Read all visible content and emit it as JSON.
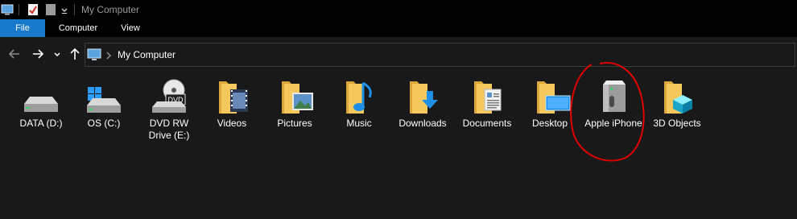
{
  "window": {
    "title": "My Computer"
  },
  "ribbon": {
    "tabs": [
      {
        "label": "File"
      },
      {
        "label": "Computer"
      },
      {
        "label": "View"
      }
    ]
  },
  "address": {
    "path": "My Computer"
  },
  "items": [
    {
      "label": "DATA (D:)",
      "icon": "hard-drive-icon"
    },
    {
      "label": "OS (C:)",
      "icon": "windows-drive-icon"
    },
    {
      "label": "DVD RW Drive (E:)",
      "icon": "dvd-drive-icon",
      "badge": "DVD"
    },
    {
      "label": "Videos",
      "icon": "videos-folder-icon"
    },
    {
      "label": "Pictures",
      "icon": "pictures-folder-icon"
    },
    {
      "label": "Music",
      "icon": "music-folder-icon"
    },
    {
      "label": "Downloads",
      "icon": "downloads-folder-icon"
    },
    {
      "label": "Documents",
      "icon": "documents-folder-icon"
    },
    {
      "label": "Desktop",
      "icon": "desktop-folder-icon"
    },
    {
      "label": "Apple iPhone",
      "icon": "apple-iphone-device-icon"
    },
    {
      "label": "3D Objects",
      "icon": "3d-objects-folder-icon"
    }
  ],
  "colors": {
    "accent": "#1979ca",
    "background": "#191919",
    "annotation": "#e00000",
    "folder": "#f4c85c"
  }
}
